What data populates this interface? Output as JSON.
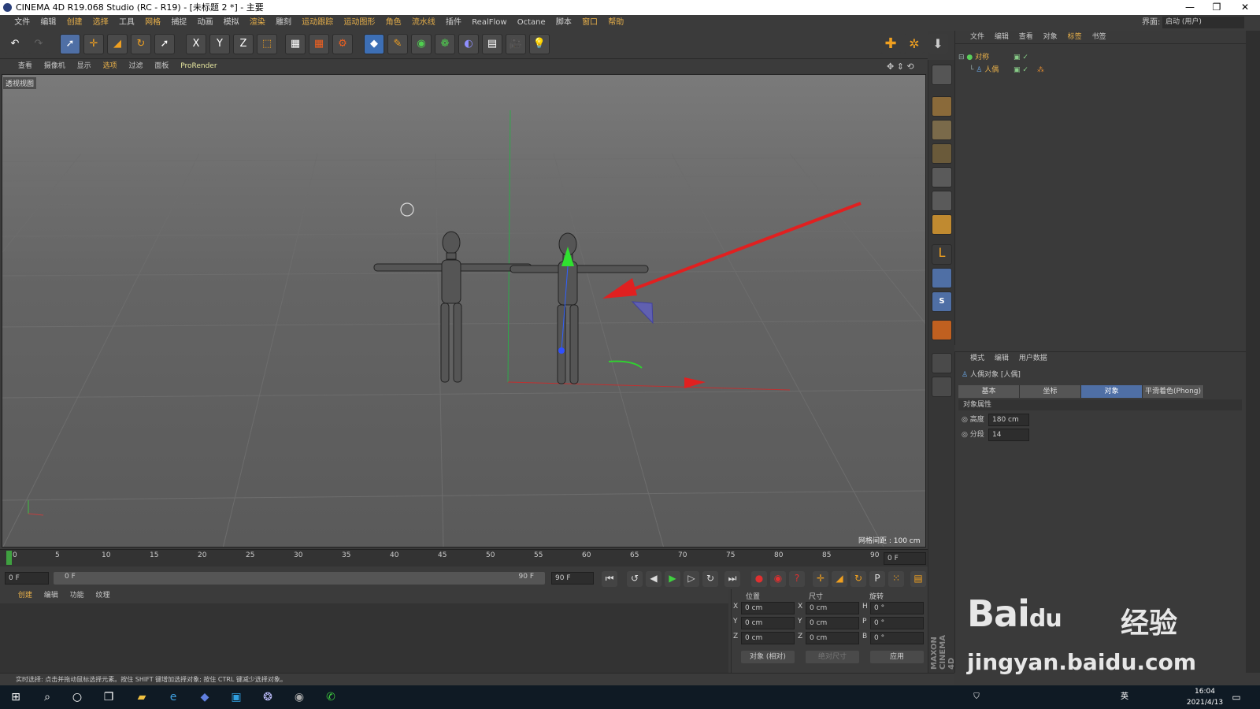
{
  "window": {
    "title": "CINEMA 4D R19.068 Studio (RC - R19) - [未标题 2 *] - 主要",
    "min": "—",
    "max": "❐",
    "close": "✕"
  },
  "menu": {
    "items": [
      "文件",
      "编辑",
      "创建",
      "选择",
      "工具",
      "网格",
      "捕捉",
      "动画",
      "模拟",
      "渲染",
      "雕刻",
      "运动跟踪",
      "运动图形",
      "角色",
      "流水线",
      "插件",
      "RealFlow",
      "Octane",
      "脚本",
      "窗口",
      "帮助"
    ],
    "layout_label": "界面:",
    "layout_value": "启动 (用户)"
  },
  "toolbar": {
    "undo_icon": "undo-icon",
    "x_label": "X",
    "y_label": "Y",
    "z_label": "Z"
  },
  "viewport_menu": {
    "items": [
      "查看",
      "摄像机",
      "显示",
      "选项",
      "过滤",
      "面板",
      "ProRender"
    ]
  },
  "viewport": {
    "label": "透视视图",
    "grid_info": "网格间距 : 100 cm"
  },
  "timeline": {
    "ticks": [
      "0",
      "5",
      "10",
      "15",
      "20",
      "25",
      "30",
      "35",
      "40",
      "45",
      "50",
      "55",
      "60",
      "65",
      "70",
      "75",
      "80",
      "85",
      "90"
    ],
    "end_frame": "0 F"
  },
  "transport": {
    "start": "0 F",
    "range_start": "0 F",
    "range_end": "90 F",
    "end": "90 F"
  },
  "material_tabs": [
    "创建",
    "编辑",
    "功能",
    "纹理"
  ],
  "coords": {
    "headers": [
      "位置",
      "尺寸",
      "旋转"
    ],
    "rows": [
      {
        "axis": "X",
        "pos": "0 cm",
        "size_axis": "X",
        "size": "0 cm",
        "rot_axis": "H",
        "rot": "0 °"
      },
      {
        "axis": "Y",
        "pos": "0 cm",
        "size_axis": "Y",
        "size": "0 cm",
        "rot_axis": "P",
        "rot": "0 °"
      },
      {
        "axis": "Z",
        "pos": "0 cm",
        "size_axis": "Z",
        "size": "0 cm",
        "rot_axis": "B",
        "rot": "0 °"
      }
    ],
    "mode": "对象 (相对)",
    "size_mode": "绝对尺寸",
    "apply": "应用"
  },
  "status": "实时选择: 点击并拖动鼠标选择元素。按住 SHIFT 键增加选择对象; 按住 CTRL 键减少选择对象。",
  "object_manager": {
    "tabs": [
      "文件",
      "编辑",
      "查看",
      "对象",
      "标签",
      "书签"
    ],
    "objects": [
      {
        "name": "对称"
      },
      {
        "name": "人偶"
      }
    ]
  },
  "attribute_manager": {
    "tabs": [
      "模式",
      "编辑",
      "用户数据"
    ],
    "object_title": "人偶对象 [人偶]",
    "sub_tabs": [
      "基本",
      "坐标",
      "对象",
      "平滑着色(Phong)"
    ],
    "selected_tab": "对象",
    "section": "对象属性",
    "fields": [
      {
        "label": "高度",
        "value": "180 cm"
      },
      {
        "label": "分段",
        "value": "14"
      }
    ]
  },
  "taskbar": {
    "time": "16:04",
    "date": "2021/4/13",
    "ime": "英"
  },
  "watermark": {
    "brand": "Bai",
    "brand2": "du",
    "text": "经验",
    "url": "jingyan.baidu.com"
  },
  "maxon": "MAXON CINEMA 4D",
  "colors": {
    "accent": "#4f6fa5",
    "highlight": "#e8b04a",
    "arrow": "#e02020"
  }
}
